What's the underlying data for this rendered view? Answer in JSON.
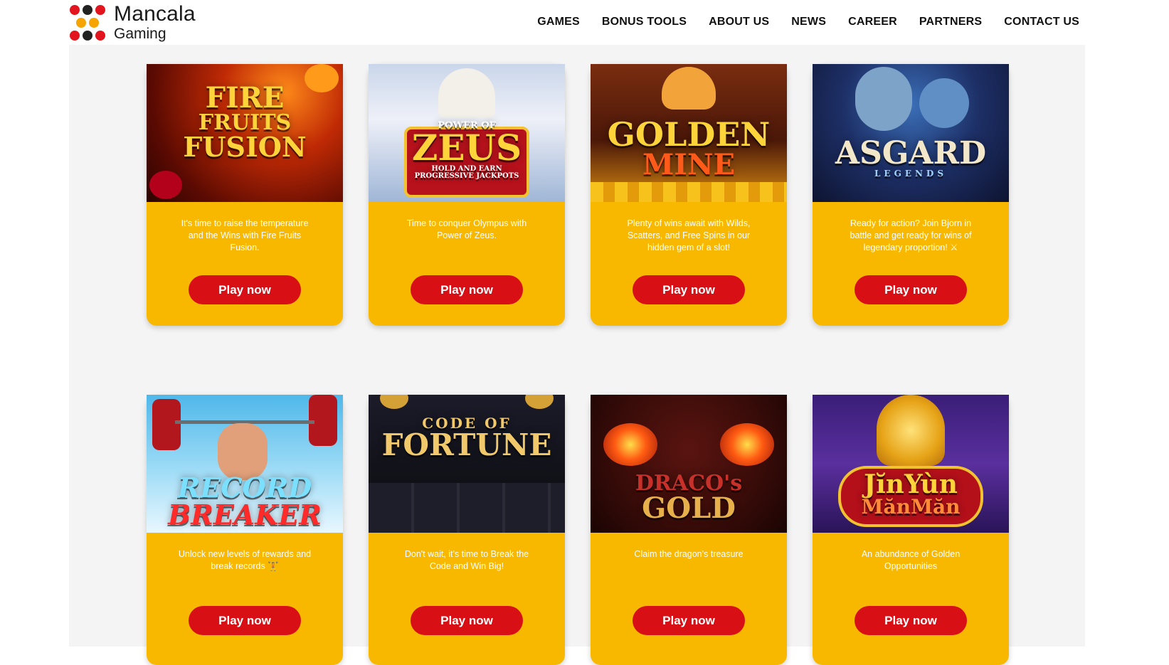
{
  "brand": {
    "name_line1": "Mancala",
    "name_line2": "Gaming"
  },
  "nav": [
    {
      "label": "GAMES"
    },
    {
      "label": "BONUS TOOLS"
    },
    {
      "label": "ABOUT US"
    },
    {
      "label": "NEWS"
    },
    {
      "label": "CAREER"
    },
    {
      "label": "PARTNERS"
    },
    {
      "label": "CONTACT US"
    }
  ],
  "colors": {
    "card_bg": "#f9b800",
    "button_bg": "#d90f16",
    "page_bg": "#f4f4f4"
  },
  "games": [
    {
      "title": "FIRE FRUITS FUSION",
      "art_lines": [
        "FIRE",
        "FRUITS",
        "FUSION"
      ],
      "description": "It's time to raise the temperature and the Wins with Fire Fruits Fusion.",
      "button": "Play now"
    },
    {
      "title": "POWER OF ZEUS",
      "art_lines": [
        "POWER OF",
        "ZEUS",
        "HOLD AND EARN PROGRESSIVE JACKPOTS"
      ],
      "description": "Time to conquer Olympus with Power of Zeus.",
      "button": "Play now"
    },
    {
      "title": "GOLDEN MINE",
      "art_lines": [
        "GOLDEN",
        "MINE"
      ],
      "description": "Plenty of wins await with Wilds, Scatters, and Free Spins in our hidden gem of a slot!",
      "button": "Play now"
    },
    {
      "title": "ASGARD LEGENDS",
      "art_lines": [
        "ASGARD",
        "LEGENDS"
      ],
      "description": "Ready for action? Join Bjorn in battle and get ready for wins of legendary proportion! ⚔",
      "button": "Play now"
    },
    {
      "title": "RECORD BREAKER",
      "art_lines": [
        "RECORD",
        "BREAKER"
      ],
      "description": "Unlock new levels of rewards and break records 🏋",
      "button": "Play now"
    },
    {
      "title": "CODE OF FORTUNE",
      "art_lines": [
        "CODE OF",
        "FORTUNE"
      ],
      "description": "Don't wait, it's time to Break the Code and Win Big!",
      "button": "Play now"
    },
    {
      "title": "DRACO'S GOLD",
      "art_lines": [
        "DRACO's",
        "GOLD"
      ],
      "description": "Claim the dragon's treasure",
      "button": "Play now"
    },
    {
      "title": "JINYUN MANMAN",
      "art_lines": [
        "JĭnYùn",
        "MănMăn"
      ],
      "description": "An abundance of Golden Opportunities",
      "button": "Play now"
    }
  ]
}
